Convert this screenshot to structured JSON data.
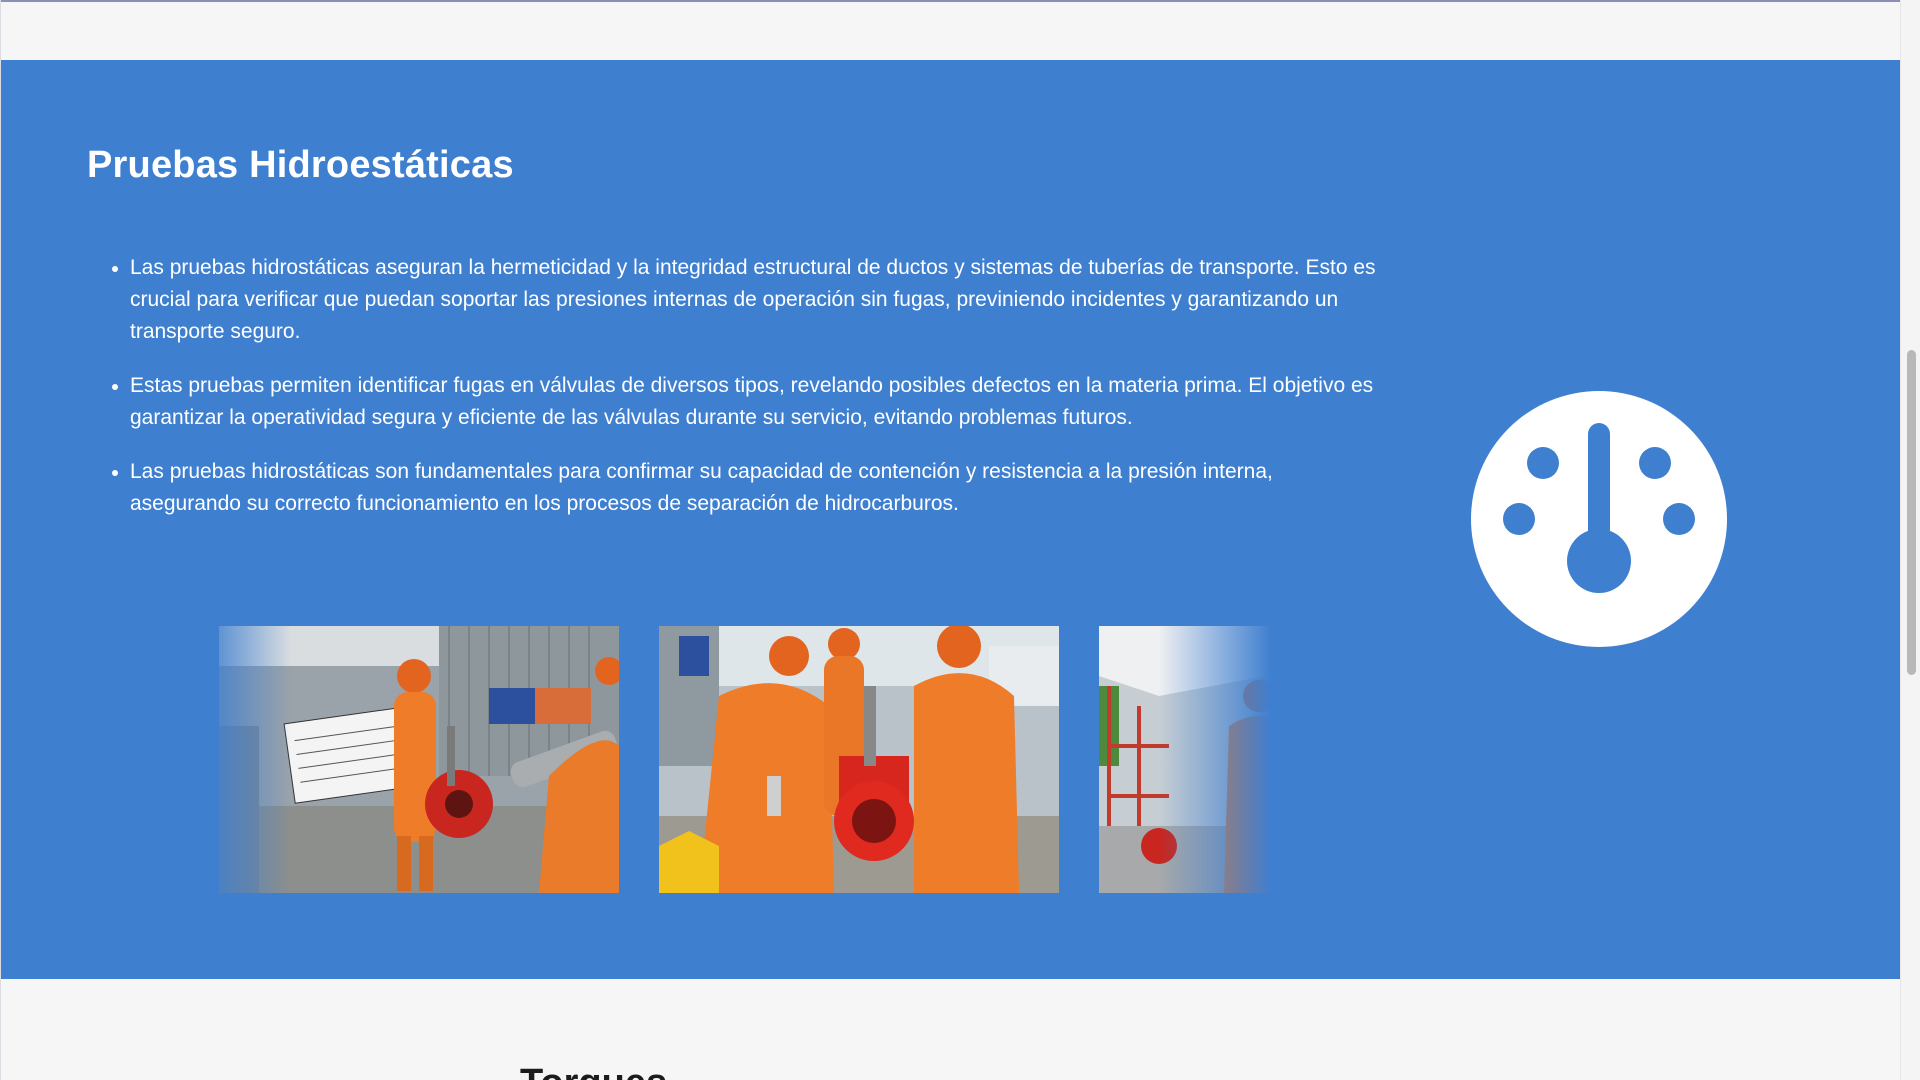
{
  "section": {
    "title": "Pruebas Hidroestáticas",
    "bullets": [
      "Las pruebas hidrostáticas aseguran la hermeticidad y la integridad estructural de ductos y sistemas de tuberías de transporte. Esto es crucial para verificar que puedan soportar las presiones internas de operación sin fugas, previniendo incidentes y garantizando un transporte seguro.",
      "Estas pruebas permiten identificar fugas en válvulas de diversos tipos, revelando posibles defectos en la materia prima. El objetivo es garantizar la operatividad segura y eficiente de las válvulas durante su servicio, evitando problemas futuros.",
      "Las pruebas hidrostáticas son fundamentales para confirmar su capacidad de contención y resistencia a la presión interna, asegurando su correcto funcionamiento en los procesos de separación de hidrocarburos."
    ],
    "icon": "gauge-icon"
  },
  "gallery": {
    "photos": [
      {
        "name": "photo-partial-left"
      },
      {
        "name": "photo-valve-inspection-sign"
      },
      {
        "name": "photo-red-valve-workers"
      },
      {
        "name": "photo-worker-outdoor"
      }
    ]
  },
  "next_section": {
    "title": "Torques"
  },
  "colors": {
    "section_bg": "#3f7fd0",
    "page_bg": "#f6f6f7",
    "text_on_blue": "#ffffff"
  }
}
